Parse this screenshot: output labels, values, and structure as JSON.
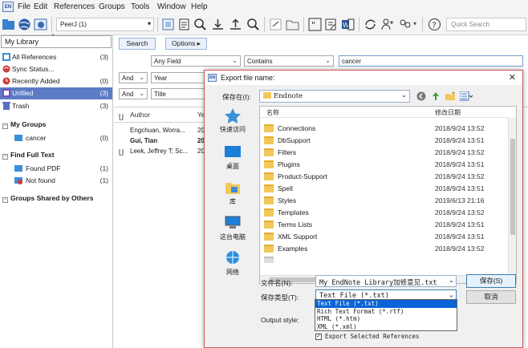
{
  "menu": [
    "File",
    "Edit",
    "References",
    "Groups",
    "Tools",
    "Window",
    "Help"
  ],
  "app_icon": "EN",
  "toolbar": {
    "style_select": "PeerJ (1)",
    "quick_search_placeholder": "Quick Search"
  },
  "left": {
    "library": "My Library",
    "groups": [
      {
        "label": "All References",
        "count": "(3)",
        "icon": "all-refs-icon"
      },
      {
        "label": "Sync Status...",
        "count": "",
        "icon": "sync-icon"
      },
      {
        "label": "Recently Added",
        "count": "(0)",
        "icon": "clock-icon"
      },
      {
        "label": "Unfiled",
        "count": "(3)",
        "icon": "unfiled-icon"
      },
      {
        "label": "Trash",
        "count": "(3)",
        "icon": "trash-icon"
      }
    ],
    "my_groups_header": "My Groups",
    "my_groups": [
      {
        "label": "cancer",
        "count": "(0)"
      }
    ],
    "find_full_text_header": "Find Full Text",
    "full_text": [
      {
        "label": "Found PDF",
        "count": "(1)"
      },
      {
        "label": "Not found",
        "count": "(1)"
      }
    ],
    "groups_shared_header": "Groups Shared by Others"
  },
  "search": {
    "search_btn": "Search",
    "options_btn": "Options ▸",
    "row1": {
      "field": "Any Field",
      "op": "Contains",
      "value": "cancer"
    },
    "row2": {
      "logic": "And",
      "field": "Year"
    },
    "row3": {
      "logic": "And",
      "field": "Title"
    }
  },
  "refs": {
    "col_author": "Author",
    "col_year": "Ye",
    "rows": [
      {
        "author": "Engchuan, Worra...",
        "year": "20",
        "bold": false
      },
      {
        "author": "Gui, Tian",
        "year": "20",
        "bold": true
      },
      {
        "author": "Leek, Jeffrey T; Sc...",
        "year": "20",
        "bold": false
      }
    ]
  },
  "dialog": {
    "title": "Export file name:",
    "save_in_label": "保存在(I):",
    "save_in_value": "Endnote",
    "places": [
      "快速访问",
      "桌面",
      "库",
      "这台电脑",
      "网络"
    ],
    "col_name": "名称",
    "col_date": "修改日期",
    "files": [
      {
        "name": "Connections",
        "date": "2018/9/24 13:52"
      },
      {
        "name": "DbSupport",
        "date": "2018/9/24 13:51"
      },
      {
        "name": "Filters",
        "date": "2018/9/24 13:52"
      },
      {
        "name": "Plugins",
        "date": "2018/9/24 13:51"
      },
      {
        "name": "Product-Support",
        "date": "2018/9/24 13:52"
      },
      {
        "name": "Spell",
        "date": "2018/9/24 13:51"
      },
      {
        "name": "Styles",
        "date": "2019/6/13 21:16"
      },
      {
        "name": "Templates",
        "date": "2018/9/24 13:52"
      },
      {
        "name": "Terms Lists",
        "date": "2018/9/24 13:51"
      },
      {
        "name": "XML Support",
        "date": "2018/9/24 13:51"
      },
      {
        "name": "Examples",
        "date": "2018/9/24 13:52"
      }
    ],
    "filename_label": "文件名(N):",
    "filename_value": "My EndNote Library加修意见.txt",
    "filetype_label": "保存类型(T):",
    "filetype_value": "Text File (*.txt)",
    "save_btn": "保存(S)",
    "cancel_btn": "取消",
    "output_style_label": "Output style:",
    "filetype_options": [
      "Text File (*.txt)",
      "Rich Text Format (*.rtf)",
      "HTML (*.htm)",
      "XML (*.xml)"
    ],
    "export_selected": "Export Selected References"
  },
  "colors": {
    "selected": "#5c7cc7",
    "highlight": "#0a64d6",
    "folder": "#f2c85a",
    "dialog_border": "#d05a5a"
  }
}
